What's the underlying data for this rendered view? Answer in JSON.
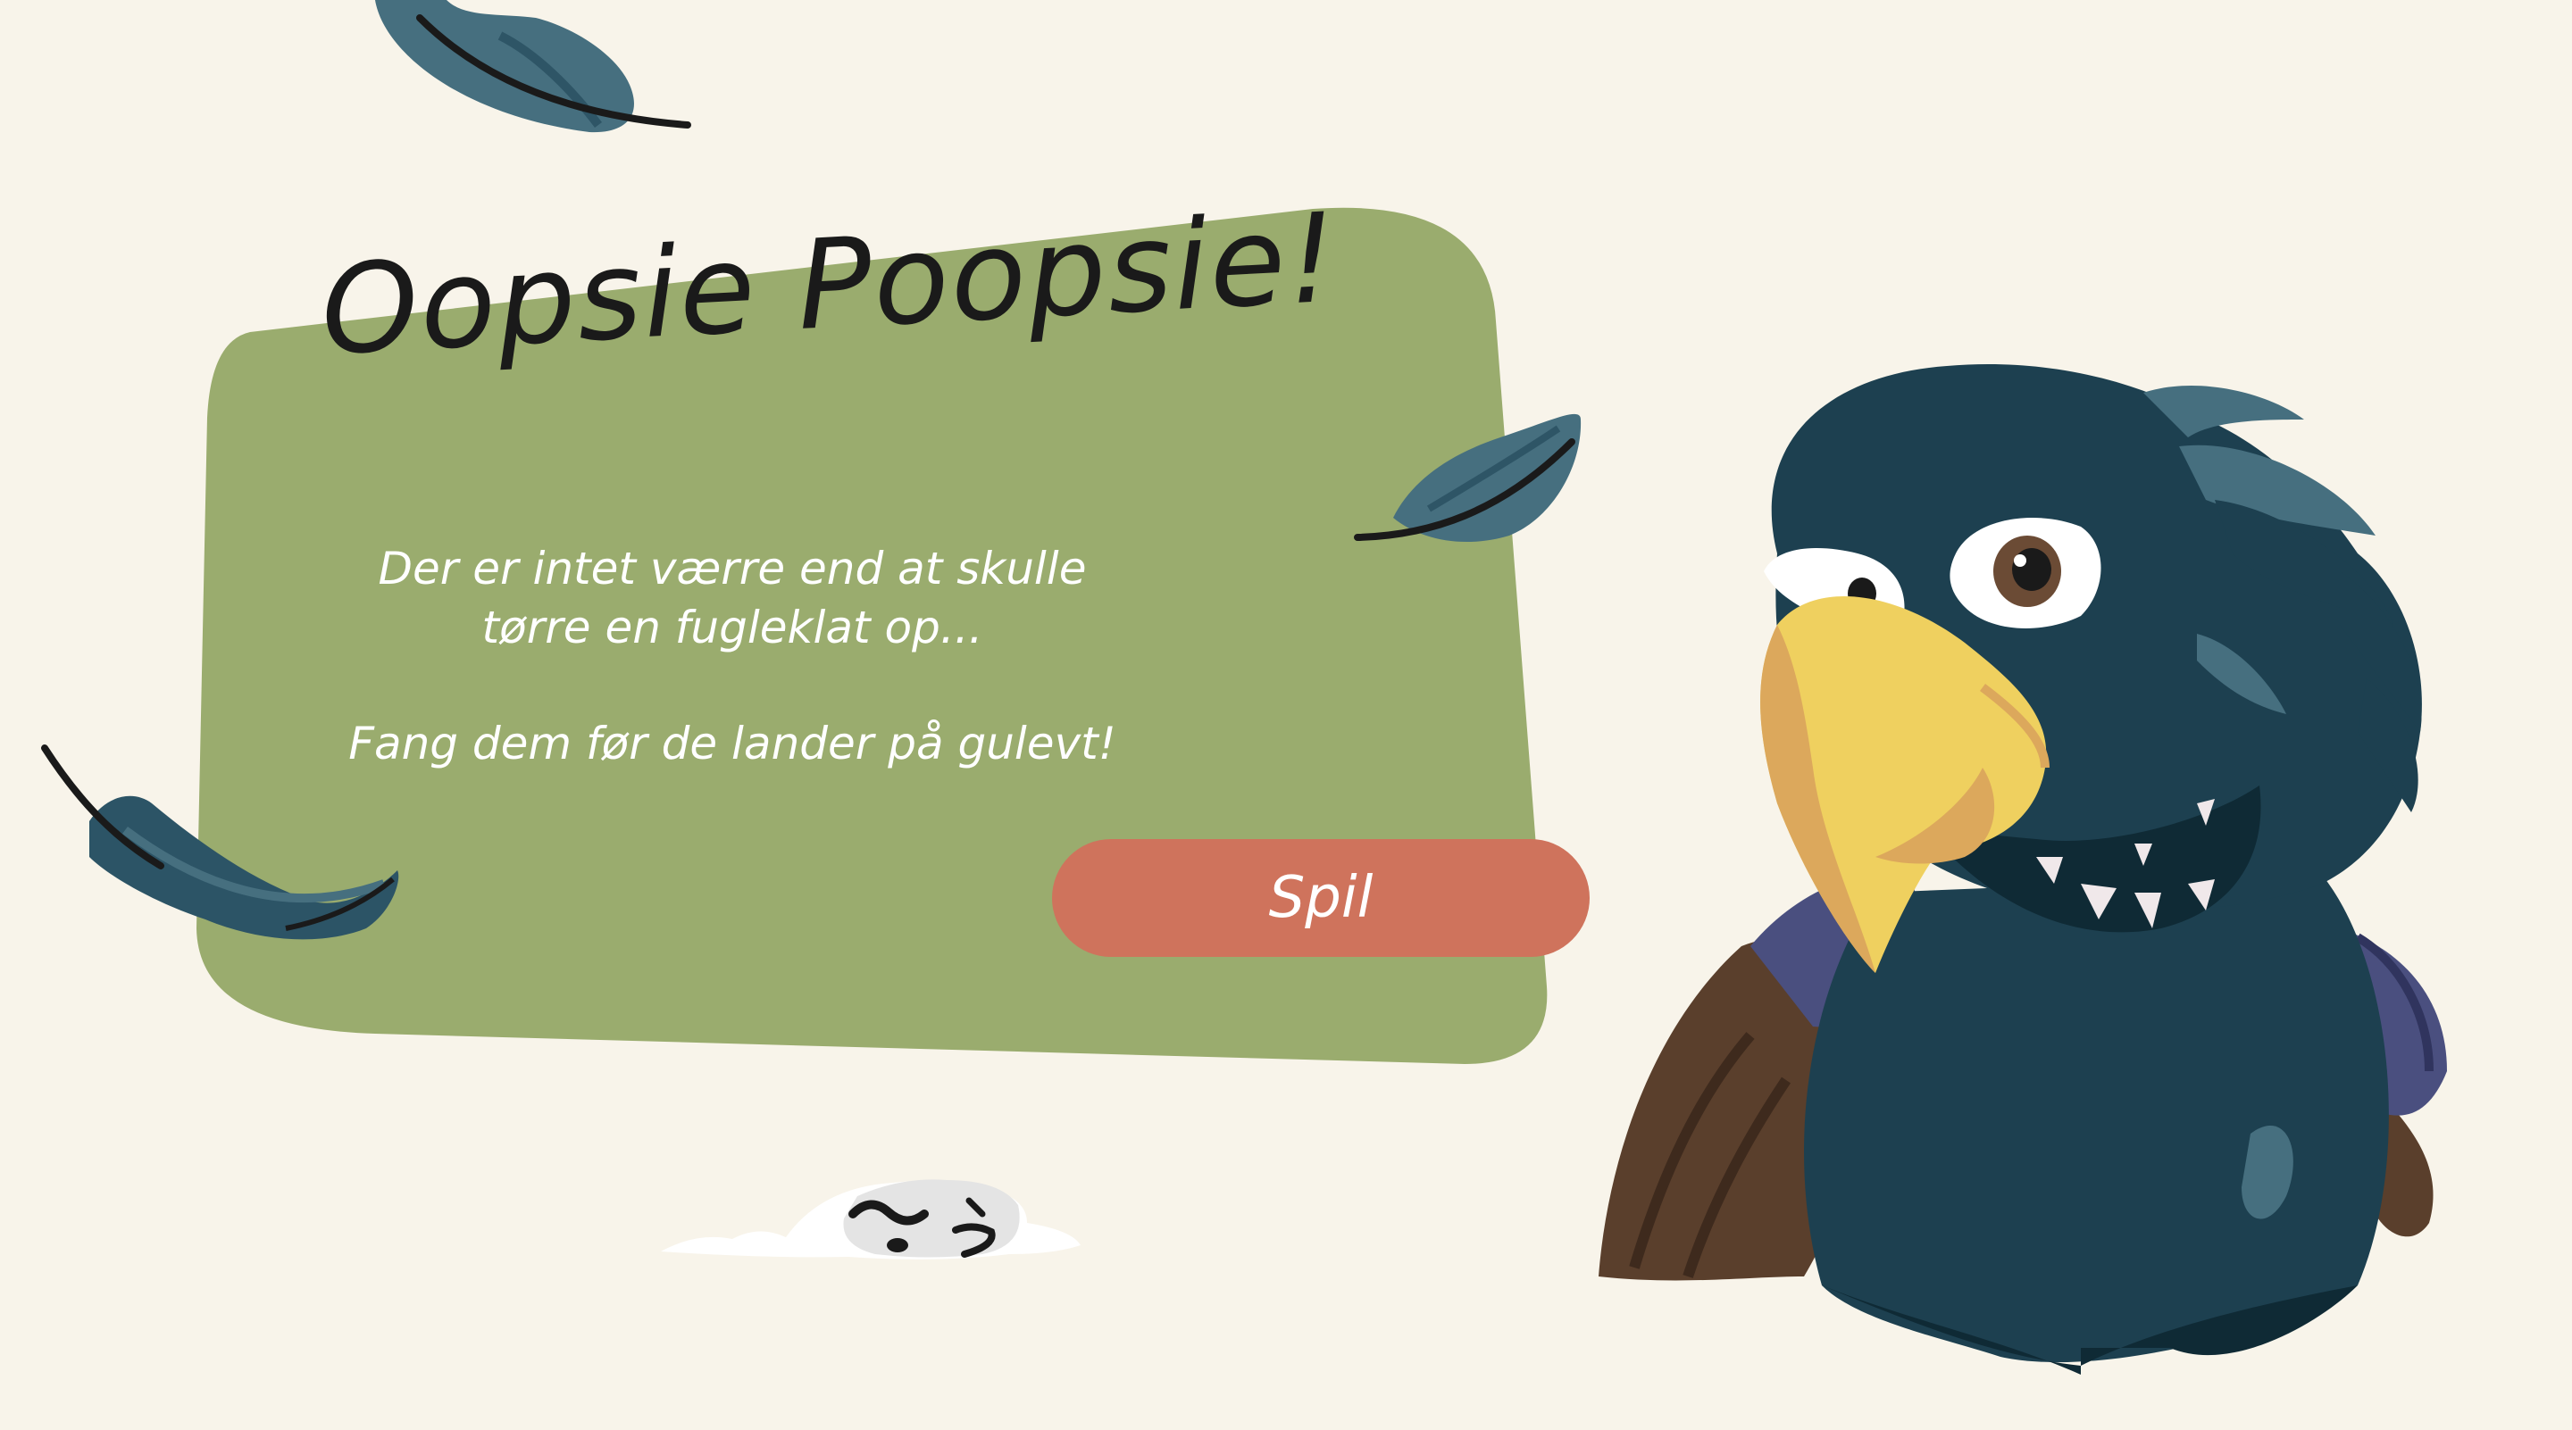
{
  "game": {
    "title": "Oopsie Poopsie!",
    "message_line_1": "Der er intet værre end at skulle tørre en fugleklat op...",
    "message_line_2": "Fang dem før de lander på gulevt!",
    "play_label": "Spil"
  },
  "colors": {
    "background": "#f8f4ea",
    "panel": "#9aac6e",
    "button": "#cf735c",
    "title_text": "#1a1a1a",
    "body_text": "#ffffff",
    "feather": "#466f7f",
    "parrot_body": "#1d4050",
    "beak": "#efd05f",
    "wing": "#5a3f2c"
  },
  "icons": [
    "feather-icon",
    "parrot-icon",
    "bird-dropping-icon"
  ]
}
